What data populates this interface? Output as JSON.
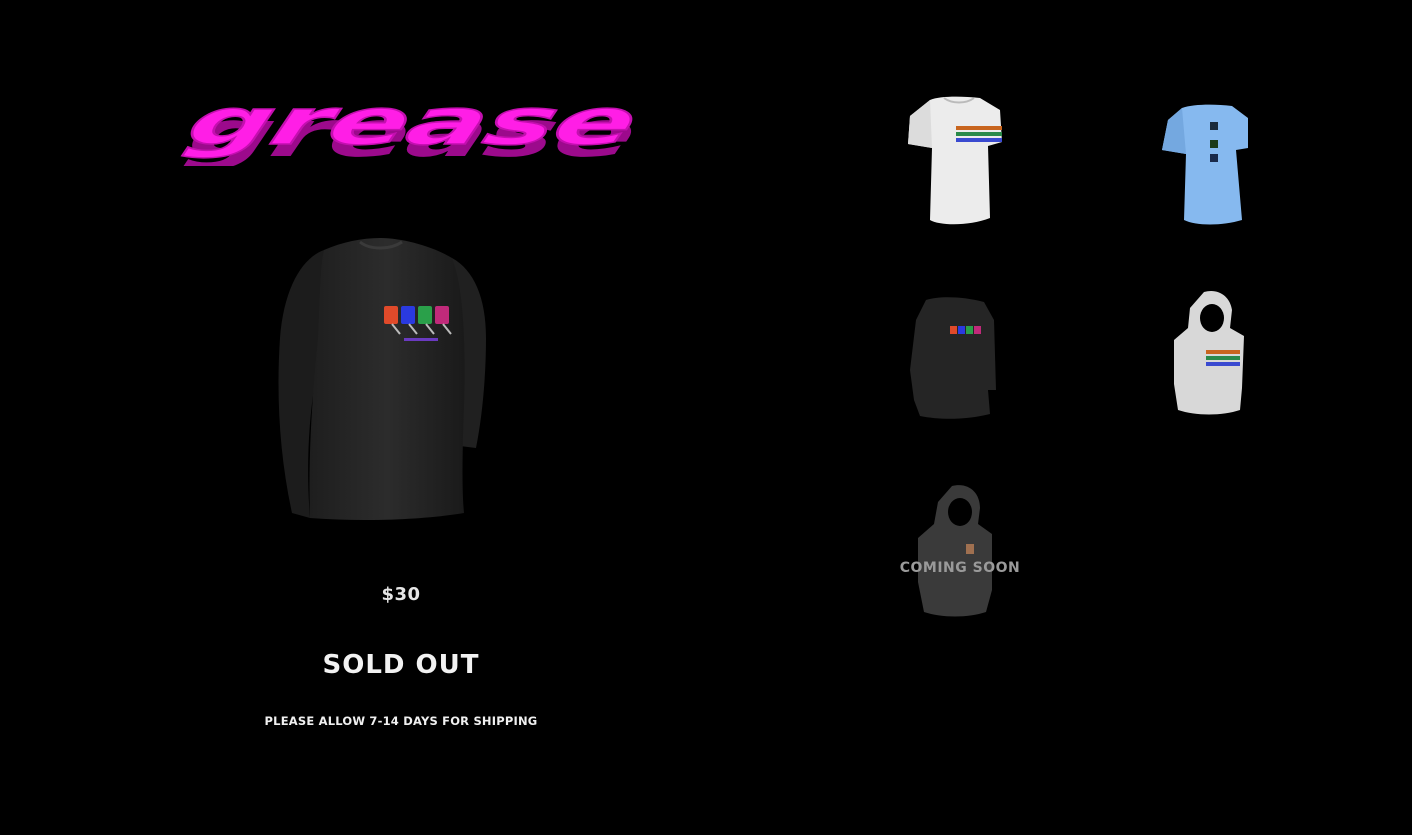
{
  "brand": {
    "logo_text": "grease",
    "logo_color": "#ff1ee6",
    "logo_shadow_color": "#9c0a8c"
  },
  "featured_product": {
    "image_icon": "black-long-sleeve-shirt",
    "price": "$30",
    "status": "SOLD OUT",
    "shipping_note": "PLEASE ALLOW 7-14 DAYS FOR SHIPPING"
  },
  "catalog": [
    {
      "name": "white-tshirt",
      "color": "#f2f2f2"
    },
    {
      "name": "blue-tshirt",
      "color": "#86b9ef"
    },
    {
      "name": "black-long-sleeve",
      "color": "#222222"
    },
    {
      "name": "white-hoodie",
      "color": "#d8d8d8"
    },
    {
      "name": "grey-hoodie",
      "color": "#3a3a3a",
      "overlay_text": "COMING SOON"
    }
  ]
}
